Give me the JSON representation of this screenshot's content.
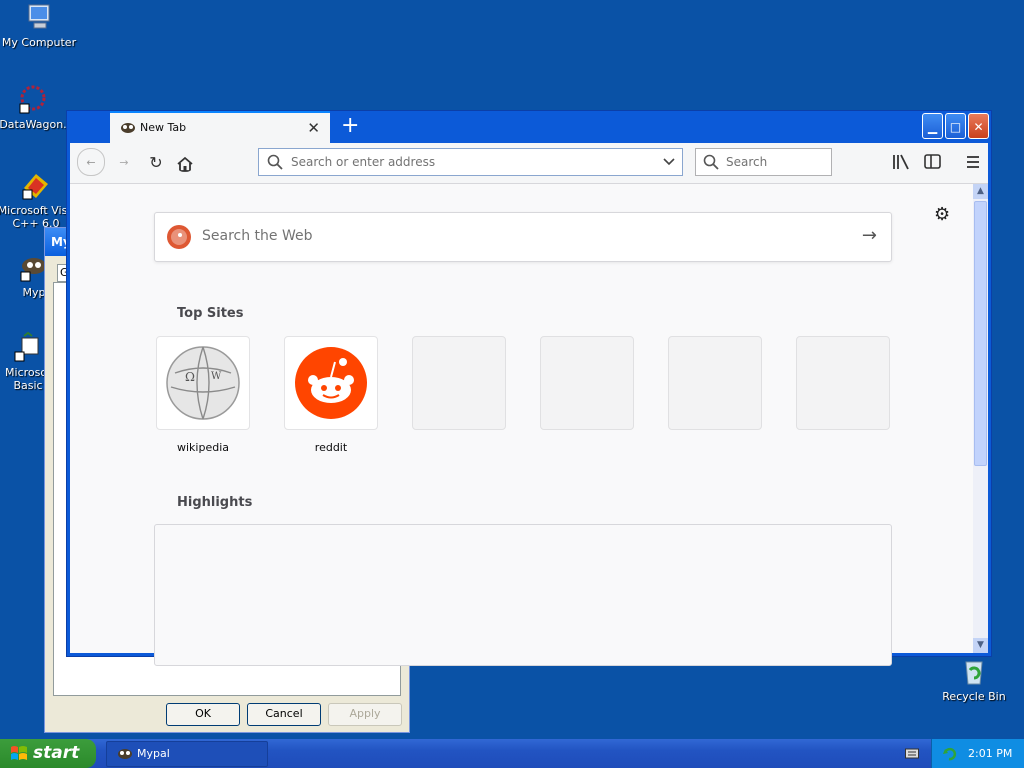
{
  "desktop": {
    "icons": [
      {
        "label": "My Computer"
      },
      {
        "label": "DataWagon."
      },
      {
        "label_line1": "Microsoft Visu",
        "label_line2": "C++ 6.0"
      },
      {
        "label": "Myp"
      },
      {
        "label_line1": "Microsof",
        "label_line2": "Basic"
      },
      {
        "label": "Recycle Bin"
      }
    ]
  },
  "background_dialog": {
    "title": "My",
    "tab": "G",
    "ok": "OK",
    "cancel": "Cancel",
    "apply": "Apply"
  },
  "browser": {
    "tab_title": "New Tab",
    "address_placeholder": "Search or enter address",
    "search_placeholder": "Search",
    "web_search_placeholder": "Search the Web",
    "top_sites_title": "Top Sites",
    "highlights_title": "Highlights",
    "top_sites": [
      {
        "label": "wikipedia"
      },
      {
        "label": "reddit"
      }
    ]
  },
  "taskbar": {
    "start_label": "start",
    "task_item": "Mypal",
    "clock": "2:01 PM"
  },
  "colors": {
    "desktop": "#0a52a6",
    "accent": "#0a84ff",
    "reddit": "#ff4500",
    "duckduckgo": "#de5833"
  }
}
